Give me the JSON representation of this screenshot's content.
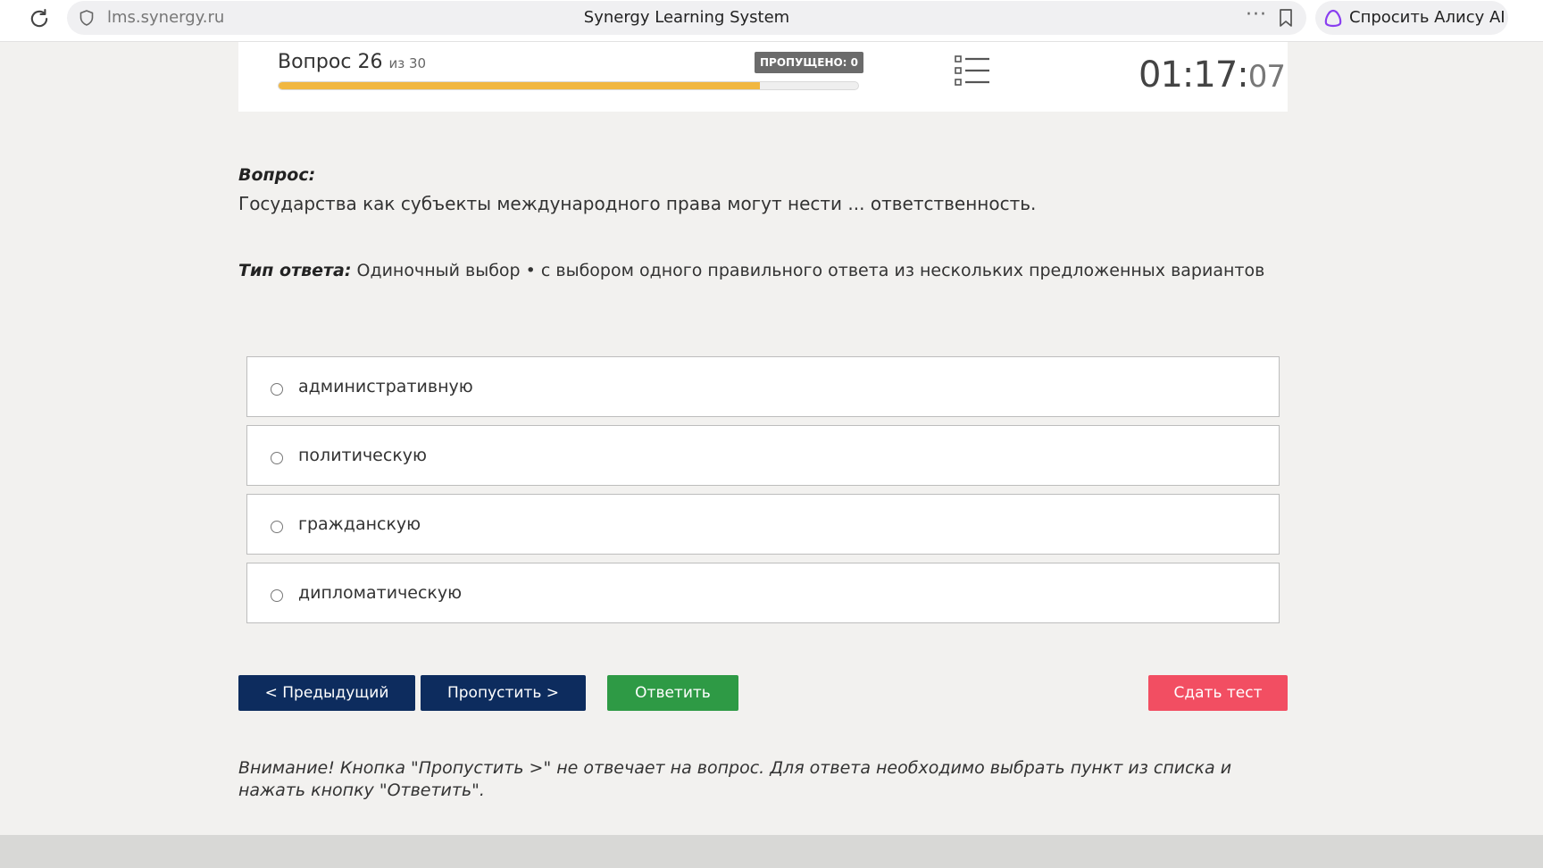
{
  "browser": {
    "url": "lms.synergy.ru",
    "title": "Synergy Learning System",
    "more_glyph": "···",
    "assistant_label": "Спросить Алису AI"
  },
  "header": {
    "question_label": "Вопрос 26",
    "question_of": "из 30",
    "skipped_badge": "ПРОПУЩЕНО: 0",
    "progress_fraction": 0.83,
    "progress_color": "#f1b740",
    "timer_main": "01:17:",
    "timer_seconds": "07"
  },
  "question": {
    "label": "Вопрос:",
    "text": "Государства как субъекты международного права могут нести ... ответственность.",
    "type_label": "Тип ответа:",
    "type_value": "Одиночный выбор • с выбором одного правильного ответа из нескольких предложенных вариантов"
  },
  "options": [
    {
      "label": "административную"
    },
    {
      "label": "политическую"
    },
    {
      "label": "гражданскую"
    },
    {
      "label": "дипломатическую"
    }
  ],
  "buttons": {
    "previous": "< Предыдущий",
    "skip": "Пропустить >",
    "answer": "Ответить",
    "submit": "Сдать тест"
  },
  "colors": {
    "nav_button": "#0d2c5e",
    "answer_button": "#2e9a45",
    "submit_button": "#f24e62"
  },
  "warning": "Внимание! Кнопка \"Пропустить >\" не отвечает на вопрос. Для ответа необходимо выбрать пункт из списка и нажать кнопку \"Ответить\"."
}
